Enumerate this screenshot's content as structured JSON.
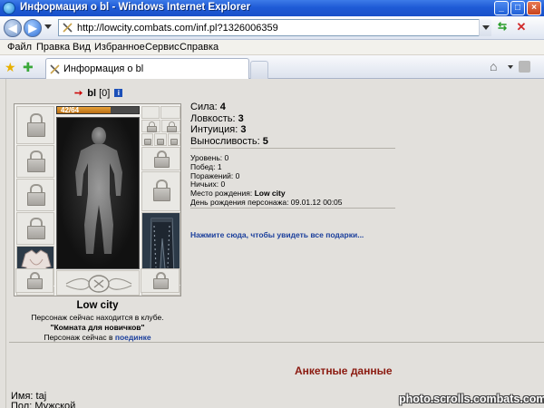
{
  "window": {
    "title": "Информация о bl - Windows Internet Explorer",
    "minimize_icon": "minimize-icon",
    "maximize_icon": "maximize-icon",
    "close_icon": "close-icon"
  },
  "address": {
    "url": "http://lowcity.combats.com/inf.pl?1326006359"
  },
  "menu": {
    "items": [
      "Файл",
      "Правка",
      "Вид",
      "Избранное",
      "Сервис",
      "Справка"
    ]
  },
  "tabs": [
    {
      "label": "Информация о bl",
      "active": true
    }
  ],
  "character": {
    "name": "bl",
    "level": "[0]",
    "hp_text": "42/64",
    "hp_fraction": 0.656,
    "city": "Low city",
    "club_line": "Персонаж сейчас находится в клубе.",
    "room": "\"Комната для новичков\"",
    "duel_prefix": "Персонаж сейчас в",
    "duel_link": "поединке"
  },
  "stats": [
    {
      "label": "Сила:",
      "value": "4"
    },
    {
      "label": "Ловкость:",
      "value": "3"
    },
    {
      "label": "Интуиция:",
      "value": "3"
    },
    {
      "label": "Выносливость:",
      "value": "5"
    }
  ],
  "info": {
    "level": "Уровень: 0",
    "wins": "Побед: 1",
    "losses": "Поражений: 0",
    "draws": "Ничьих: 0",
    "birthplace_label": "Место рождения:",
    "birthplace_value": "Low city",
    "birthday": "День рождения персонажа: 09.01.12 00:05"
  },
  "gifts_link": "Нажмите сюда, чтобы увидеть все подарки...",
  "profile": {
    "heading": "Анкетные данные",
    "name_label": "Имя:",
    "name_value": "taj",
    "sex_label": "Пол:",
    "sex_value": "Мужской"
  },
  "watermark": "photo.scrolls.combats.com",
  "colors": {
    "titlebar": "#1f5bd6",
    "page_bg": "#e2e0dc",
    "heading_red": "#8b1a10",
    "link_blue": "#1b3f9c"
  }
}
